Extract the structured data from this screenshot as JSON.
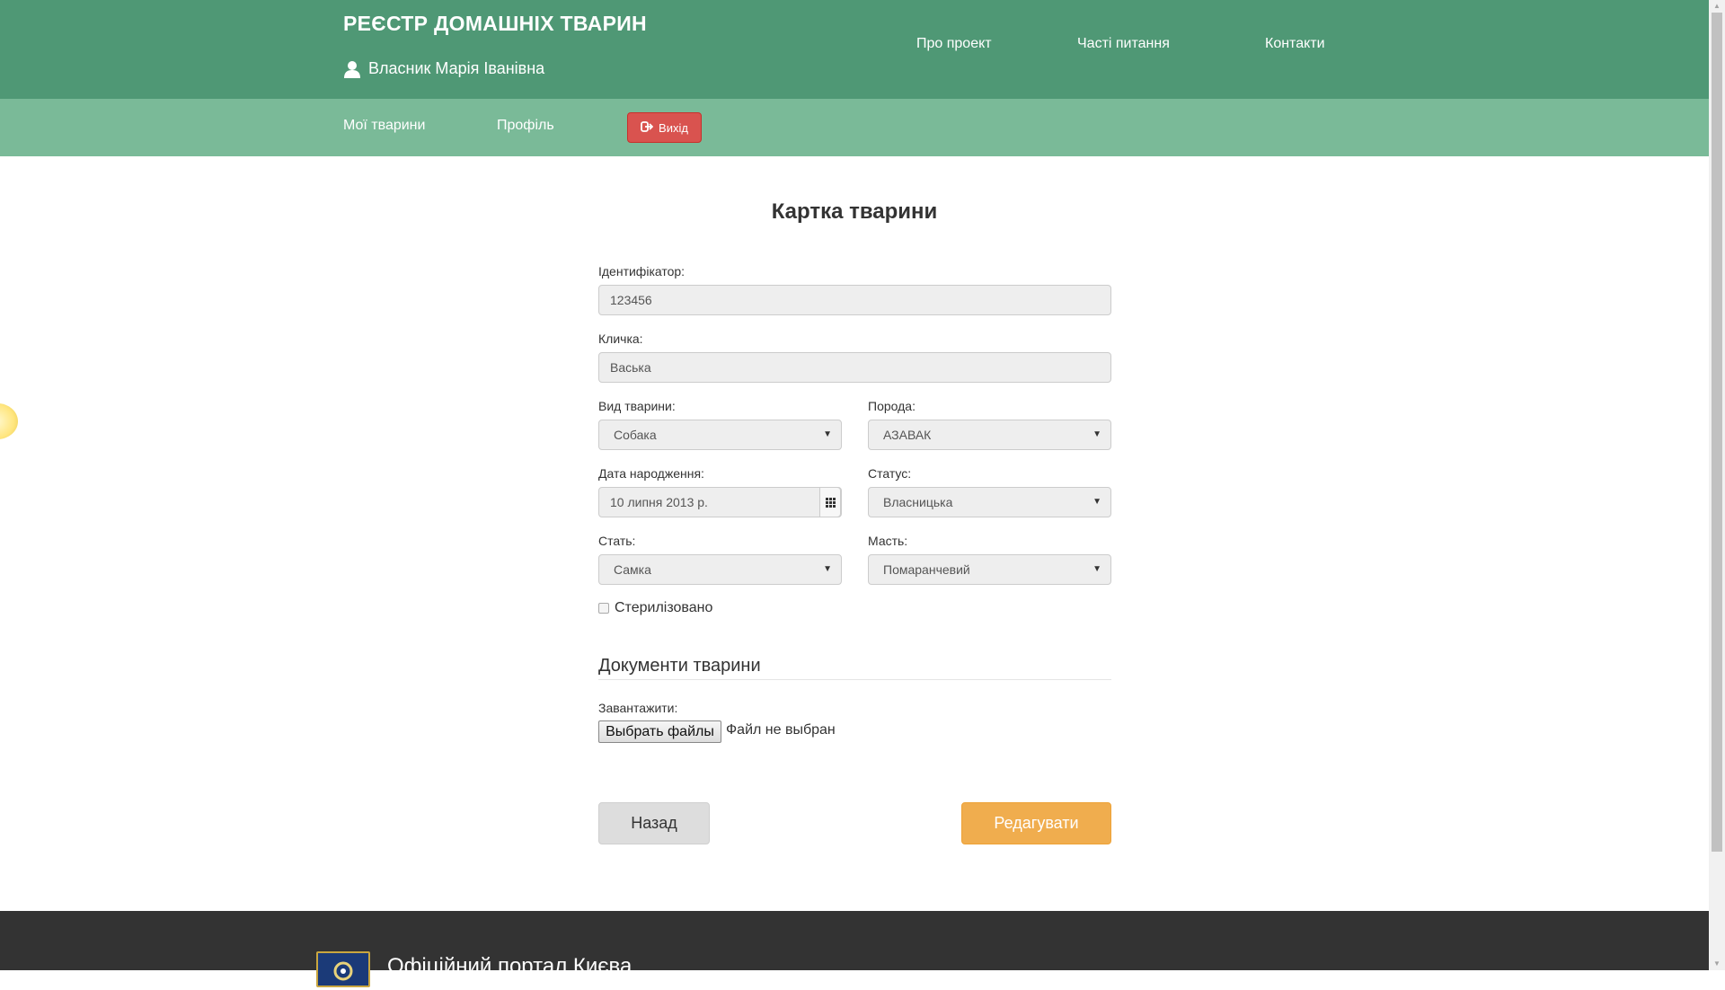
{
  "header": {
    "site_title": "РЕЄСТР ДОМАШНІХ ТВАРИН",
    "user_name": "Власник Марія Іванівна",
    "links": [
      "Про проект",
      "Часті питання",
      "Контакти"
    ]
  },
  "subnav": {
    "items": [
      "Мої тварини",
      "Профіль"
    ],
    "logout_label": "Вихід"
  },
  "form": {
    "title": "Картка тварини",
    "id_label": "Ідентифікатор:",
    "id_value": "123456",
    "name_label": "Кличка:",
    "name_value": "Васька",
    "species_label": "Вид тварини:",
    "species_value": "Собака",
    "breed_label": "Порода:",
    "breed_value": "АЗАВАК",
    "birth_label": "Дата народження:",
    "birth_value": "10 липня 2013 р.",
    "status_label": "Статус:",
    "status_value": "Власницька",
    "sex_label": "Стать:",
    "sex_value": "Самка",
    "color_label": "Масть:",
    "color_value": "Помаранчевий",
    "sterilized_label": "Стерилізовано",
    "sterilized_checked": false
  },
  "documents": {
    "title": "Документи тварини",
    "upload_label": "Завантажити:",
    "file_button": "Выбрать файлы",
    "file_status": "Файл не выбран"
  },
  "actions": {
    "back_label": "Назад",
    "edit_label": "Редагувати"
  },
  "footer": {
    "portal_text": "Офіційний портал Києва"
  },
  "colors": {
    "header_bg": "#4f9875",
    "subnav_bg": "#7aba98",
    "logout_bg": "#d9534f",
    "edit_bg": "#f0ad4e",
    "footer_bg": "#333333"
  },
  "icons": {
    "user": "user-icon",
    "logout": "sign-out-icon",
    "calendar": "calendar-icon",
    "caret": "chevron-down-icon"
  }
}
